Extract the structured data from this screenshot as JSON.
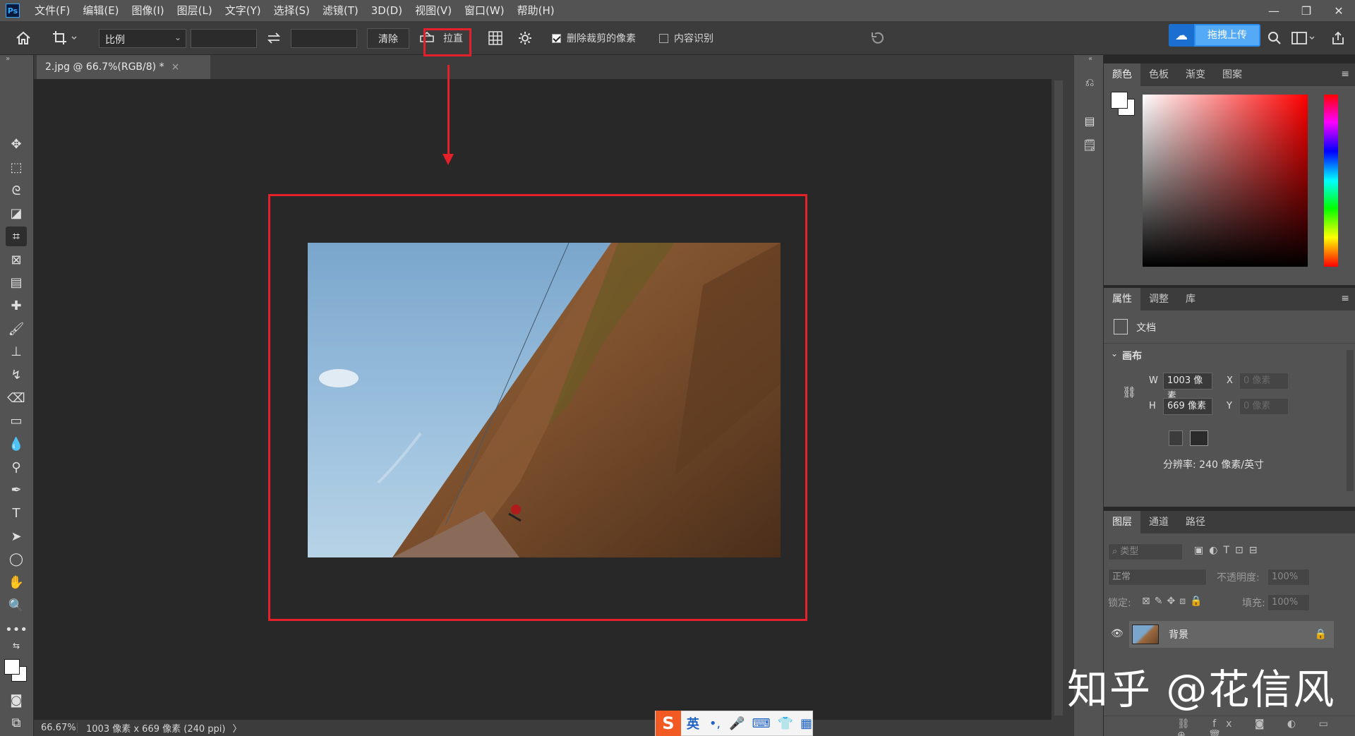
{
  "app": {
    "logo": "Ps"
  },
  "menu": [
    "文件(F)",
    "编辑(E)",
    "图像(I)",
    "图层(L)",
    "文字(Y)",
    "选择(S)",
    "滤镜(T)",
    "3D(D)",
    "视图(V)",
    "窗口(W)",
    "帮助(H)"
  ],
  "window_controls": [
    "minimize-icon",
    "restore-icon",
    "close-icon"
  ],
  "options": {
    "ratio_label": "比例",
    "width_value": "",
    "height_value": "",
    "clear_label": "清除",
    "straighten_label": "拉直",
    "delete_cropped_label": "删除裁剪的像素",
    "delete_cropped_checked": true,
    "content_aware_label": "内容识别",
    "content_aware_checked": false,
    "upload_label": "拖拽上传"
  },
  "document": {
    "tab_title": "2.jpg @ 66.7%(RGB/8) *",
    "tab_close": "×"
  },
  "status": {
    "zoom": "66.67%",
    "info": "1003 像素 x 669 像素 (240 ppi)",
    "arrow": "〉"
  },
  "color_panel": {
    "tabs": [
      "颜色",
      "色板",
      "渐变",
      "图案"
    ],
    "active": 0,
    "foreground": "#ffffff",
    "background": "#ffffff"
  },
  "properties_panel": {
    "tabs": [
      "属性",
      "调整",
      "库"
    ],
    "active": 0,
    "doc_label": "文档",
    "canvas_label": "画布",
    "w_label": "W",
    "w_value": "1003 像素",
    "h_label": "H",
    "h_value": "669 像素",
    "x_label": "X",
    "x_placeholder": "0 像素",
    "y_label": "Y",
    "y_placeholder": "0 像素",
    "resolution": "分辨率: 240 像素/英寸"
  },
  "layers_panel": {
    "tabs": [
      "图层",
      "通道",
      "路径"
    ],
    "active": 0,
    "filter_placeholder": "类型",
    "blend_mode": "正常",
    "opacity_label": "不透明度:",
    "opacity_value": "100%",
    "lock_label": "锁定:",
    "fill_label": "填充:",
    "fill_value": "100%",
    "layers": [
      {
        "name": "背景",
        "visible": true,
        "locked": true
      }
    ]
  },
  "watermark": "知乎 @花信风",
  "ime": {
    "logo": "S",
    "mode": "英",
    "punct": "•,",
    "icons": [
      "mic-icon",
      "keyboard-icon",
      "shirt-icon",
      "grid-icon"
    ]
  },
  "colors": {
    "annotation_red": "#e4202a",
    "accent_blue": "#2a8ef0"
  }
}
